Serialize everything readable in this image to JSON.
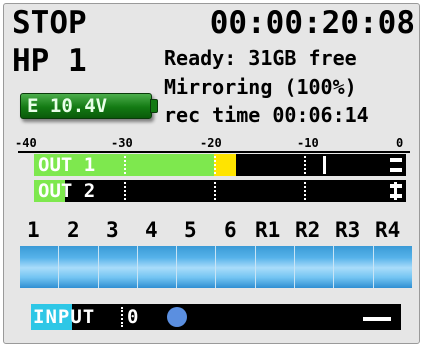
{
  "header": {
    "status": "STOP",
    "timecode": "00:00:20:08",
    "headphone": "HP 1"
  },
  "info": {
    "ready": "Ready: 31GB free",
    "mirroring": "Mirroring (100%)",
    "rec_time": "rec time 00:06:14"
  },
  "battery": {
    "label": "E 10.4V",
    "color": "#137a13"
  },
  "meter_scale": {
    "ticks": [
      "-40",
      "-30",
      "-20",
      "-10",
      "0"
    ]
  },
  "outputs": [
    {
      "label": "OUT 1",
      "level_db": -22,
      "peak_db": -20,
      "fill_color": "#7ee84e",
      "peak_color": "#ffe400"
    },
    {
      "label": "OUT 2",
      "level_db": null
    }
  ],
  "channels": {
    "labels": [
      "1",
      "2",
      "3",
      "4",
      "5",
      "6",
      "R1",
      "R2",
      "R3",
      "R4"
    ],
    "color": "#57b3ea"
  },
  "input": {
    "label": "INPUT",
    "value": "0",
    "accent": "#2ec7e6",
    "knob_color": "#5b8fe0"
  }
}
